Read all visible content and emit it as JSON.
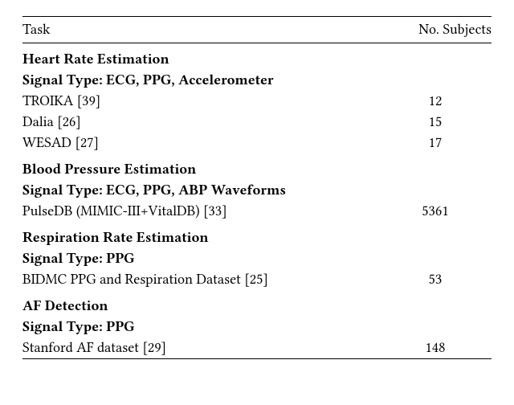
{
  "header": {
    "task": "Task",
    "subjects_col": "No. Subjects"
  },
  "groups": [
    {
      "title": "Heart Rate Estimation",
      "signal": "Signal Type: ECG, PPG, Accelerometer",
      "rows": [
        {
          "label": "TROIKA [39]",
          "value": "12"
        },
        {
          "label": "Dalia [26]",
          "value": "15"
        },
        {
          "label": "WESAD [27]",
          "value": "17"
        }
      ]
    },
    {
      "title": "Blood Pressure Estimation",
      "signal": "Signal Type: ECG, PPG, ABP Waveforms",
      "rows": [
        {
          "label": "PulseDB (MIMIC-III+VitalDB) [33]",
          "value": "5361"
        }
      ]
    },
    {
      "title": "Respiration Rate Estimation",
      "signal": "Signal Type: PPG",
      "rows": [
        {
          "label": "BIDMC PPG and Respiration Dataset [25]",
          "value": "53"
        }
      ]
    },
    {
      "title": "AF Detection",
      "signal": "Signal Type: PPG",
      "rows": [
        {
          "label": "Stanford AF dataset [29]",
          "value": "148"
        }
      ]
    }
  ]
}
